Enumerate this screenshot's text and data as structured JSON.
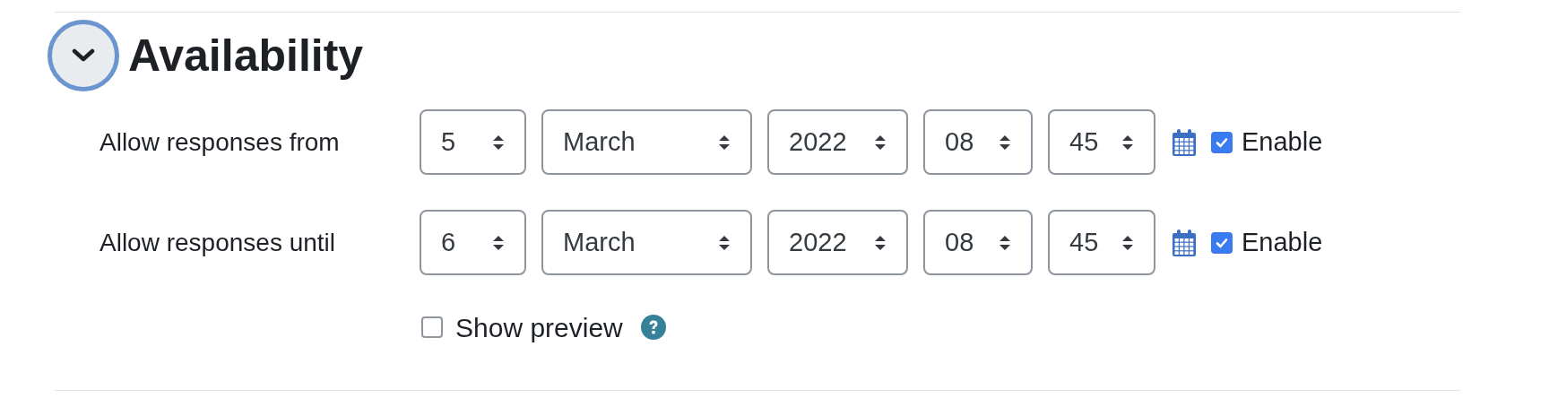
{
  "section": {
    "title": "Availability",
    "expanded": true
  },
  "date_rows": [
    {
      "label": "Allow responses from",
      "day": "5",
      "month": "March",
      "year": "2022",
      "hour": "08",
      "minute": "45",
      "enable": {
        "label": "Enable",
        "checked": true
      }
    },
    {
      "label": "Allow responses until",
      "day": "6",
      "month": "March",
      "year": "2022",
      "hour": "08",
      "minute": "45",
      "enable": {
        "label": "Enable",
        "checked": true
      }
    }
  ],
  "show_preview": {
    "label": "Show preview",
    "checked": false
  }
}
